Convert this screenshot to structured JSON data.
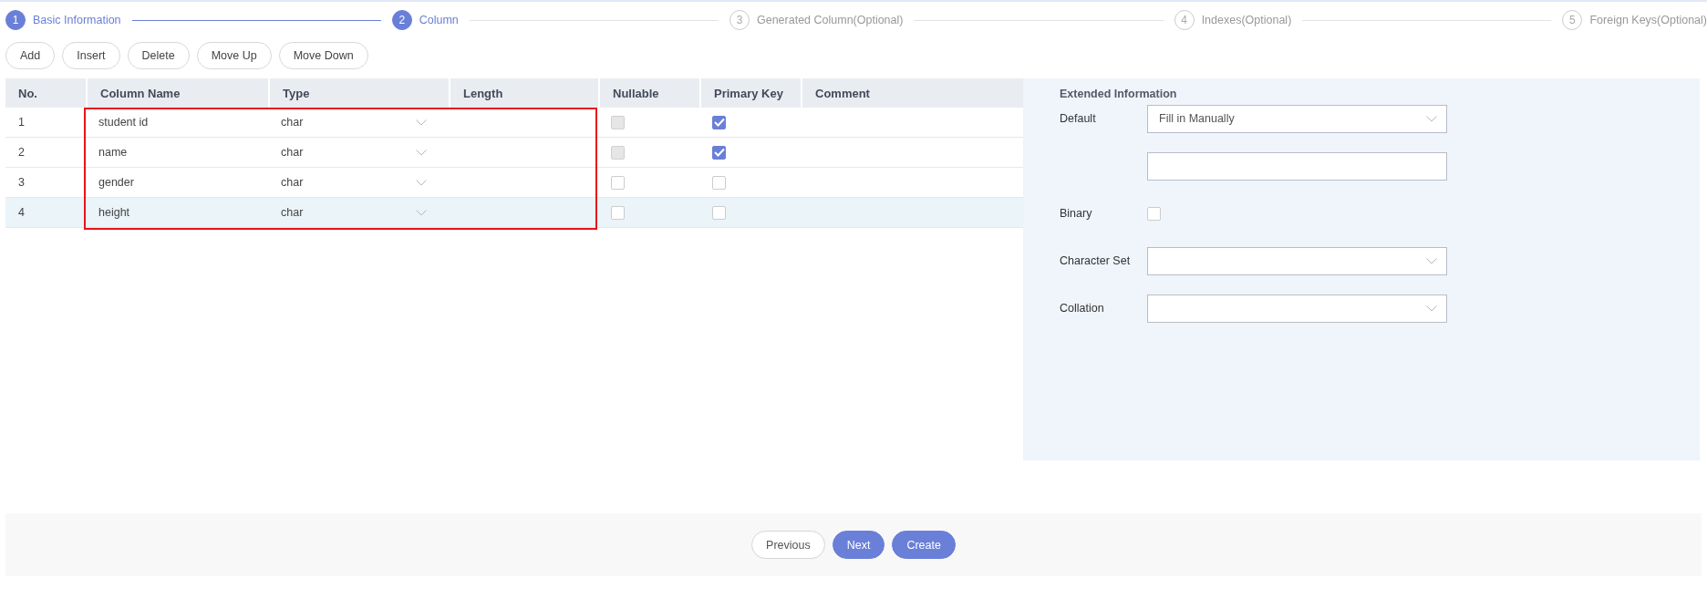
{
  "steps": [
    {
      "number": "1",
      "label": "Basic Information",
      "active": true
    },
    {
      "number": "2",
      "label": "Column",
      "active": true
    },
    {
      "number": "3",
      "label": "Generated Column(Optional)",
      "active": false
    },
    {
      "number": "4",
      "label": "Indexes(Optional)",
      "active": false
    },
    {
      "number": "5",
      "label": "Foreign Keys(Optional)",
      "active": false
    }
  ],
  "toolbar": [
    "Add",
    "Insert",
    "Delete",
    "Move Up",
    "Move Down"
  ],
  "table": {
    "columns": [
      "No.",
      "Column Name",
      "Type",
      "Length",
      "Nullable",
      "Primary Key",
      "Comment"
    ],
    "rows": [
      {
        "no": "1",
        "name": "student id",
        "type": "char",
        "nullable": {
          "checked": false,
          "disabled": true
        },
        "primary_key": true,
        "selected": false
      },
      {
        "no": "2",
        "name": "name",
        "type": "char",
        "nullable": {
          "checked": false,
          "disabled": true
        },
        "primary_key": true,
        "selected": false
      },
      {
        "no": "3",
        "name": "gender",
        "type": "char",
        "nullable": {
          "checked": false,
          "disabled": false
        },
        "primary_key": false,
        "selected": false
      },
      {
        "no": "4",
        "name": "height",
        "type": "char",
        "nullable": {
          "checked": false,
          "disabled": false
        },
        "primary_key": false,
        "selected": true
      }
    ]
  },
  "extended": {
    "title": "Extended Information",
    "fields": [
      {
        "kind": "select",
        "label": "Default",
        "value": "Fill in Manually"
      },
      {
        "kind": "input"
      },
      {
        "kind": "checkbox",
        "label": "Binary",
        "checked": false
      },
      {
        "kind": "select",
        "label": "Character Set"
      },
      {
        "kind": "select",
        "label": "Collation"
      }
    ]
  },
  "footer": [
    {
      "label": "Previous",
      "primary": false
    },
    {
      "label": "Next",
      "primary": true
    },
    {
      "label": "Create",
      "primary": true
    }
  ]
}
